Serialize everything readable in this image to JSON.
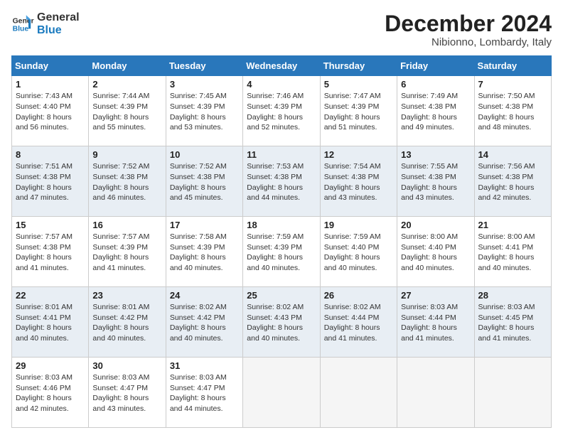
{
  "logo": {
    "line1": "General",
    "line2": "Blue"
  },
  "title": "December 2024",
  "subtitle": "Nibionno, Lombardy, Italy",
  "days_header": [
    "Sunday",
    "Monday",
    "Tuesday",
    "Wednesday",
    "Thursday",
    "Friday",
    "Saturday"
  ],
  "weeks": [
    [
      {
        "day": "1",
        "sunrise": "7:43 AM",
        "sunset": "4:40 PM",
        "daylight": "8 hours and 56 minutes."
      },
      {
        "day": "2",
        "sunrise": "7:44 AM",
        "sunset": "4:39 PM",
        "daylight": "8 hours and 55 minutes."
      },
      {
        "day": "3",
        "sunrise": "7:45 AM",
        "sunset": "4:39 PM",
        "daylight": "8 hours and 53 minutes."
      },
      {
        "day": "4",
        "sunrise": "7:46 AM",
        "sunset": "4:39 PM",
        "daylight": "8 hours and 52 minutes."
      },
      {
        "day": "5",
        "sunrise": "7:47 AM",
        "sunset": "4:39 PM",
        "daylight": "8 hours and 51 minutes."
      },
      {
        "day": "6",
        "sunrise": "7:49 AM",
        "sunset": "4:38 PM",
        "daylight": "8 hours and 49 minutes."
      },
      {
        "day": "7",
        "sunrise": "7:50 AM",
        "sunset": "4:38 PM",
        "daylight": "8 hours and 48 minutes."
      }
    ],
    [
      {
        "day": "8",
        "sunrise": "7:51 AM",
        "sunset": "4:38 PM",
        "daylight": "8 hours and 47 minutes."
      },
      {
        "day": "9",
        "sunrise": "7:52 AM",
        "sunset": "4:38 PM",
        "daylight": "8 hours and 46 minutes."
      },
      {
        "day": "10",
        "sunrise": "7:52 AM",
        "sunset": "4:38 PM",
        "daylight": "8 hours and 45 minutes."
      },
      {
        "day": "11",
        "sunrise": "7:53 AM",
        "sunset": "4:38 PM",
        "daylight": "8 hours and 44 minutes."
      },
      {
        "day": "12",
        "sunrise": "7:54 AM",
        "sunset": "4:38 PM",
        "daylight": "8 hours and 43 minutes."
      },
      {
        "day": "13",
        "sunrise": "7:55 AM",
        "sunset": "4:38 PM",
        "daylight": "8 hours and 43 minutes."
      },
      {
        "day": "14",
        "sunrise": "7:56 AM",
        "sunset": "4:38 PM",
        "daylight": "8 hours and 42 minutes."
      }
    ],
    [
      {
        "day": "15",
        "sunrise": "7:57 AM",
        "sunset": "4:38 PM",
        "daylight": "8 hours and 41 minutes."
      },
      {
        "day": "16",
        "sunrise": "7:57 AM",
        "sunset": "4:39 PM",
        "daylight": "8 hours and 41 minutes."
      },
      {
        "day": "17",
        "sunrise": "7:58 AM",
        "sunset": "4:39 PM",
        "daylight": "8 hours and 40 minutes."
      },
      {
        "day": "18",
        "sunrise": "7:59 AM",
        "sunset": "4:39 PM",
        "daylight": "8 hours and 40 minutes."
      },
      {
        "day": "19",
        "sunrise": "7:59 AM",
        "sunset": "4:40 PM",
        "daylight": "8 hours and 40 minutes."
      },
      {
        "day": "20",
        "sunrise": "8:00 AM",
        "sunset": "4:40 PM",
        "daylight": "8 hours and 40 minutes."
      },
      {
        "day": "21",
        "sunrise": "8:00 AM",
        "sunset": "4:41 PM",
        "daylight": "8 hours and 40 minutes."
      }
    ],
    [
      {
        "day": "22",
        "sunrise": "8:01 AM",
        "sunset": "4:41 PM",
        "daylight": "8 hours and 40 minutes."
      },
      {
        "day": "23",
        "sunrise": "8:01 AM",
        "sunset": "4:42 PM",
        "daylight": "8 hours and 40 minutes."
      },
      {
        "day": "24",
        "sunrise": "8:02 AM",
        "sunset": "4:42 PM",
        "daylight": "8 hours and 40 minutes."
      },
      {
        "day": "25",
        "sunrise": "8:02 AM",
        "sunset": "4:43 PM",
        "daylight": "8 hours and 40 minutes."
      },
      {
        "day": "26",
        "sunrise": "8:02 AM",
        "sunset": "4:44 PM",
        "daylight": "8 hours and 41 minutes."
      },
      {
        "day": "27",
        "sunrise": "8:03 AM",
        "sunset": "4:44 PM",
        "daylight": "8 hours and 41 minutes."
      },
      {
        "day": "28",
        "sunrise": "8:03 AM",
        "sunset": "4:45 PM",
        "daylight": "8 hours and 41 minutes."
      }
    ],
    [
      {
        "day": "29",
        "sunrise": "8:03 AM",
        "sunset": "4:46 PM",
        "daylight": "8 hours and 42 minutes."
      },
      {
        "day": "30",
        "sunrise": "8:03 AM",
        "sunset": "4:47 PM",
        "daylight": "8 hours and 43 minutes."
      },
      {
        "day": "31",
        "sunrise": "8:03 AM",
        "sunset": "4:47 PM",
        "daylight": "8 hours and 44 minutes."
      },
      null,
      null,
      null,
      null
    ]
  ],
  "labels": {
    "sunrise": "Sunrise:",
    "sunset": "Sunset:",
    "daylight": "Daylight:"
  }
}
